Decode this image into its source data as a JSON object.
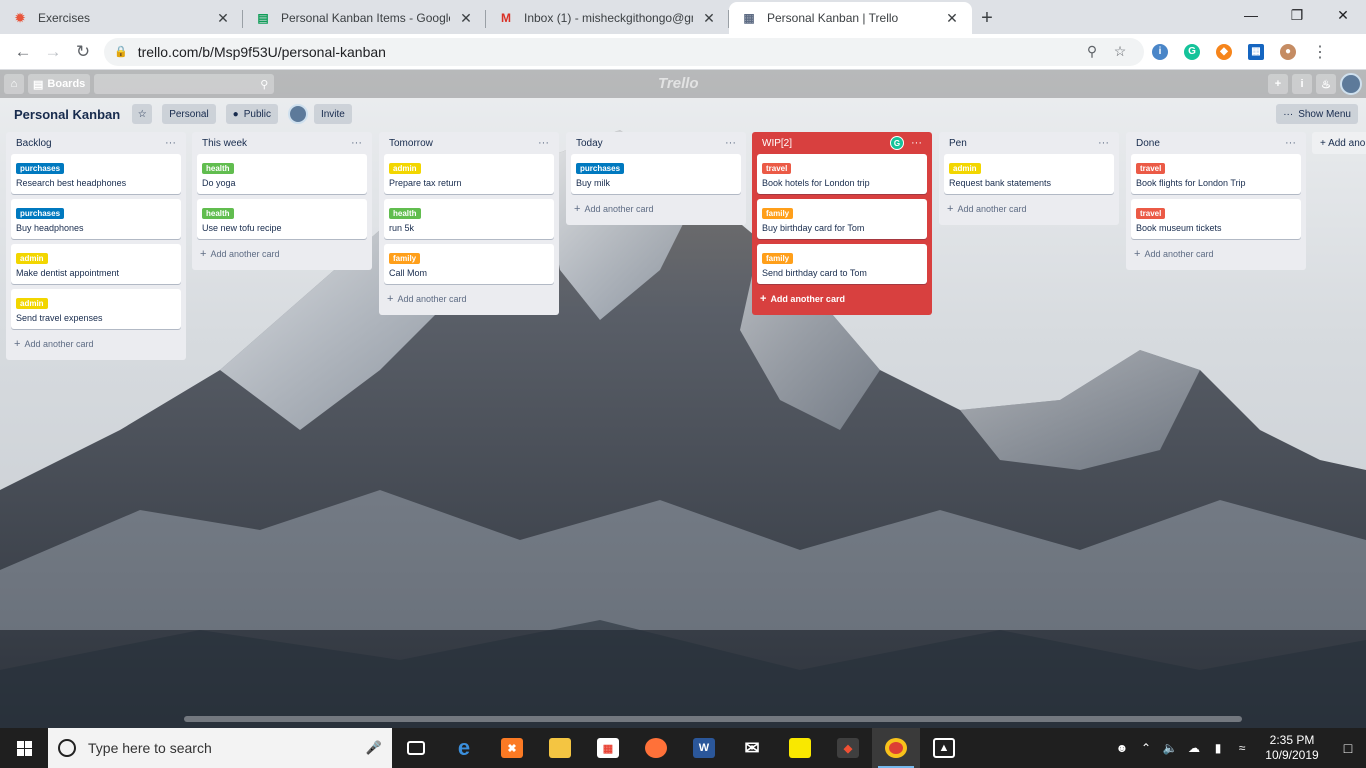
{
  "browser": {
    "tabs": [
      {
        "title": "Exercises",
        "favicon": "exercise-icon",
        "color": "#e8553b",
        "glyph": "✹",
        "active": false
      },
      {
        "title": "Personal Kanban Items - Google",
        "favicon": "sheets-icon",
        "color": "#0f9d58",
        "glyph": "▤",
        "active": false
      },
      {
        "title": "Inbox (1) - misheckgithongo@gm",
        "favicon": "gmail-icon",
        "color": "#d93025",
        "glyph": "M",
        "active": false
      },
      {
        "title": "Personal Kanban | Trello",
        "favicon": "trello-icon",
        "color": "#5e6c84",
        "glyph": "▦",
        "active": true
      }
    ],
    "new_tab": "+",
    "url": "trello.com/b/Msp9f53U/personal-kanban"
  },
  "trello_header": {
    "boards_label": "Boards",
    "logo": "Trello"
  },
  "board": {
    "title": "Personal Kanban",
    "team": "Personal",
    "visibility": "Public",
    "invite": "Invite",
    "show_menu": "Show Menu",
    "add_list": "+ Add ano"
  },
  "label_colors": {
    "purchases": "#0079bf",
    "health": "#61bd4f",
    "admin": "#f2d600",
    "family": "#ff9f1a",
    "travel": "#eb5a46"
  },
  "lists": [
    {
      "name": "Backlog",
      "add_label": "Add another card",
      "cards": [
        {
          "label": "purchases",
          "title": "Research best headphones"
        },
        {
          "label": "purchases",
          "title": "Buy headphones"
        },
        {
          "label": "admin",
          "title": "Make dentist appointment"
        },
        {
          "label": "admin",
          "title": "Send travel expenses"
        }
      ]
    },
    {
      "name": "This week",
      "add_label": "Add another card",
      "cards": [
        {
          "label": "health",
          "title": "Do yoga"
        },
        {
          "label": "health",
          "title": "Use new tofu recipe"
        }
      ]
    },
    {
      "name": "Tomorrow",
      "add_label": "Add another card",
      "cards": [
        {
          "label": "admin",
          "title": "Prepare tax return"
        },
        {
          "label": "health",
          "title": "run 5k"
        },
        {
          "label": "family",
          "title": "Call Mom"
        }
      ]
    },
    {
      "name": "Today",
      "add_label": "Add another card",
      "cards": [
        {
          "label": "purchases",
          "title": "Buy milk"
        }
      ]
    },
    {
      "name": "WIP[2]",
      "add_label": "Add another card",
      "wip": true,
      "cards": [
        {
          "label": "travel",
          "title": "Book hotels for London trip"
        },
        {
          "label": "family",
          "title": "Buy birthday card for Tom"
        },
        {
          "label": "family",
          "title": "Send birthday card to Tom"
        }
      ]
    },
    {
      "name": "Pen",
      "add_label": "Add another card",
      "cards": [
        {
          "label": "admin",
          "title": "Request bank statements"
        }
      ]
    },
    {
      "name": "Done",
      "add_label": "Add another card",
      "cards": [
        {
          "label": "travel",
          "title": "Book flights for London Trip"
        },
        {
          "label": "travel",
          "title": "Book museum tickets"
        }
      ]
    }
  ],
  "taskbar": {
    "search_placeholder": "Type here to search",
    "time": "2:35 PM",
    "date": "10/9/2019"
  }
}
